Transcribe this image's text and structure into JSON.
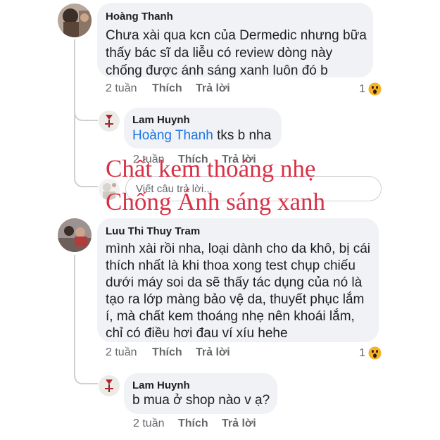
{
  "comments": [
    {
      "author": "Hoàng Thanh",
      "lines": [
        "Chưa xài qua kcn của Dermedic nhưng bữa",
        "thấy bác sĩ da liễu có review dòng này",
        "chống được ánh sáng xanh luôn đó b"
      ],
      "time": "2 tuần",
      "like_label": "Thích",
      "reply_label": "Trả lời",
      "reaction_count": "1",
      "reaction_icon": "wow-emoji-icon"
    },
    {
      "author": "Luu Thi Thuy Tram",
      "lines": [
        "mình xài rồi nha, loại dành cho da khô, bị cái",
        "thích nhất là khi thoa xong test chụp chiếu",
        "dưới máy soi da sẽ thấy tác dụng của nó là",
        "tạo ra lớp màng bảo vệ da, thuyết phục lắm",
        "í, mà chất kem thoáng nhẹ nên khoái lắm,",
        "chỉ có điều hơi đau ví xíu hehe"
      ],
      "time": "2 tuần",
      "like_label": "Thích",
      "reply_label": "Trả lời",
      "reaction_count": "1",
      "reaction_icon": "wow-emoji-icon"
    }
  ],
  "replies": [
    {
      "author": "Lam Huynh",
      "mention": "Hoàng Thanh",
      "text": " tks b nha",
      "time": "2 tuần",
      "like_label": "Thích",
      "reply_label": "Trả lời"
    },
    {
      "author": "Lam Huynh",
      "text": "b mua ở shop nào v ạ?",
      "time": "2 tuần",
      "like_label": "Thích",
      "reply_label": "Trả lời"
    }
  ],
  "reply_input": {
    "placeholder": "Viết câu trả lời..."
  },
  "overlay": {
    "line1": "Chất kem thoáng nhẹ",
    "line2": "Chống Ánh sáng xanh",
    "color": "#d93045"
  },
  "colors": {
    "bubble": "#f0f2f5",
    "mention": "#1b74e4",
    "meta": "#65676b"
  }
}
